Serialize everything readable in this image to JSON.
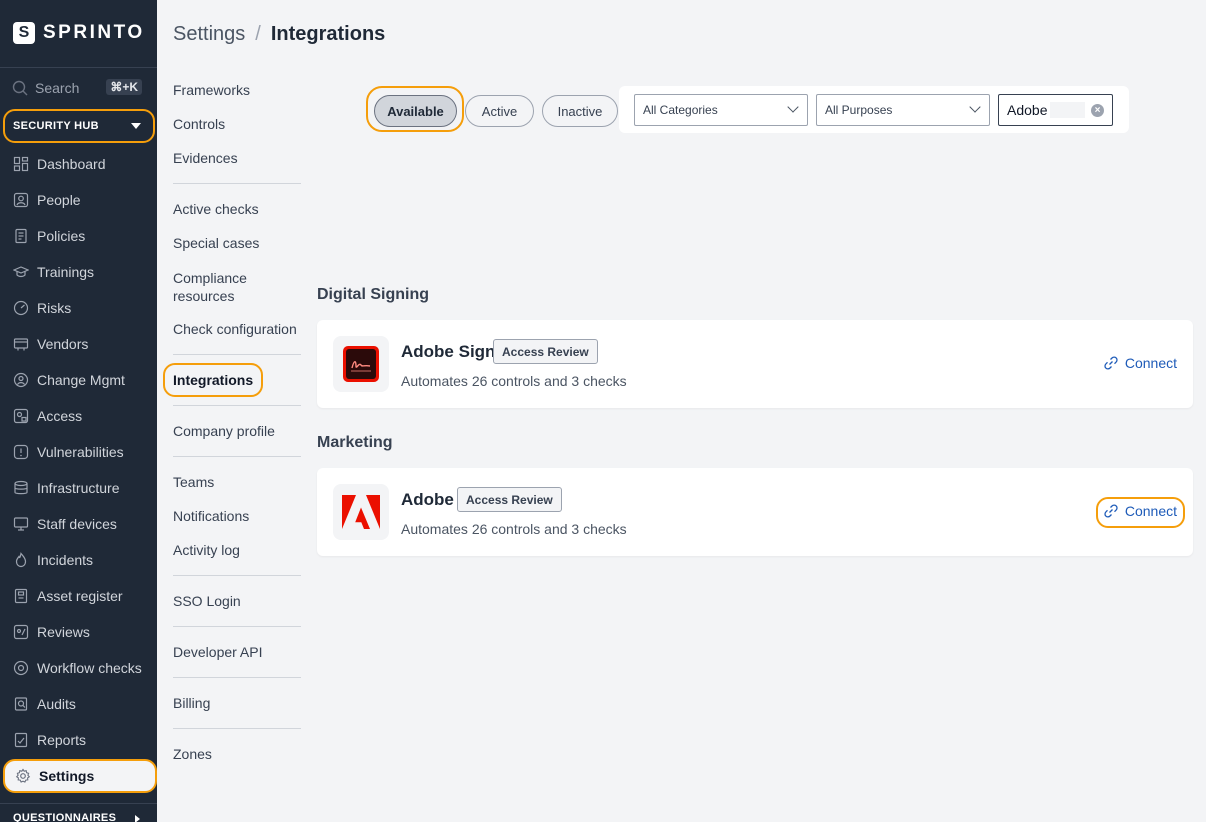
{
  "brand": {
    "logo_letter": "S",
    "name": "SPRINTO"
  },
  "sidebar": {
    "search_label": "Search",
    "search_shortcut": "⌘+K",
    "hub_label": "SECURITY HUB",
    "items": [
      {
        "label": "Dashboard",
        "icon": "dashboard-icon"
      },
      {
        "label": "People",
        "icon": "people-icon"
      },
      {
        "label": "Policies",
        "icon": "policies-icon"
      },
      {
        "label": "Trainings",
        "icon": "trainings-icon"
      },
      {
        "label": "Risks",
        "icon": "risks-icon"
      },
      {
        "label": "Vendors",
        "icon": "vendors-icon"
      },
      {
        "label": "Change Mgmt",
        "icon": "change-mgmt-icon"
      },
      {
        "label": "Access",
        "icon": "access-icon"
      },
      {
        "label": "Vulnerabilities",
        "icon": "vulnerabilities-icon"
      },
      {
        "label": "Infrastructure",
        "icon": "infrastructure-icon"
      },
      {
        "label": "Staff devices",
        "icon": "staff-devices-icon"
      },
      {
        "label": "Incidents",
        "icon": "incidents-icon"
      },
      {
        "label": "Asset register",
        "icon": "asset-register-icon"
      },
      {
        "label": "Reviews",
        "icon": "reviews-icon"
      },
      {
        "label": "Workflow checks",
        "icon": "workflow-checks-icon"
      },
      {
        "label": "Audits",
        "icon": "audits-icon"
      },
      {
        "label": "Reports",
        "icon": "reports-icon"
      },
      {
        "label": "Settings",
        "icon": "settings-icon"
      }
    ],
    "active_item": "Settings",
    "footer_label": "QUESTIONNAIRES"
  },
  "header": {
    "parent": "Settings",
    "separator": "/",
    "current": "Integrations"
  },
  "settings_menu": {
    "group1": [
      "Frameworks",
      "Controls",
      "Evidences"
    ],
    "group2": [
      "Active checks",
      "Special cases",
      "Compliance resources",
      "Check configuration"
    ],
    "group3": [
      "Integrations"
    ],
    "group4": [
      "Company profile"
    ],
    "group5": [
      "Teams",
      "Notifications",
      "Activity log"
    ],
    "group6": [
      "SSO Login"
    ],
    "group7": [
      "Developer API"
    ],
    "group8": [
      "Billing"
    ],
    "group9": [
      "Zones"
    ],
    "active": "Integrations"
  },
  "filters": {
    "tabs": [
      "Available",
      "Active",
      "Inactive"
    ],
    "selected_tab": "Available",
    "category": "All Categories",
    "purpose": "All Purposes",
    "search_value": "Adobe",
    "clear_icon": "clear-icon"
  },
  "sections": [
    {
      "title": "Digital Signing",
      "cards": [
        {
          "name": "Adobe Sign",
          "badge": "Access Review",
          "description": "Automates 26 controls and 3 checks",
          "action": "Connect",
          "logo": "adobe-sign-logo"
        }
      ]
    },
    {
      "title": "Marketing",
      "cards": [
        {
          "name": "Adobe",
          "badge": "Access Review",
          "description": "Automates 26 controls and 3 checks",
          "action": "Connect",
          "logo": "adobe-logo"
        }
      ]
    }
  ],
  "colors": {
    "sidebar_bg": "#1f2937",
    "highlight": "#f59e0b",
    "link": "#1e5bb8",
    "adobe_red": "#eb1000"
  }
}
